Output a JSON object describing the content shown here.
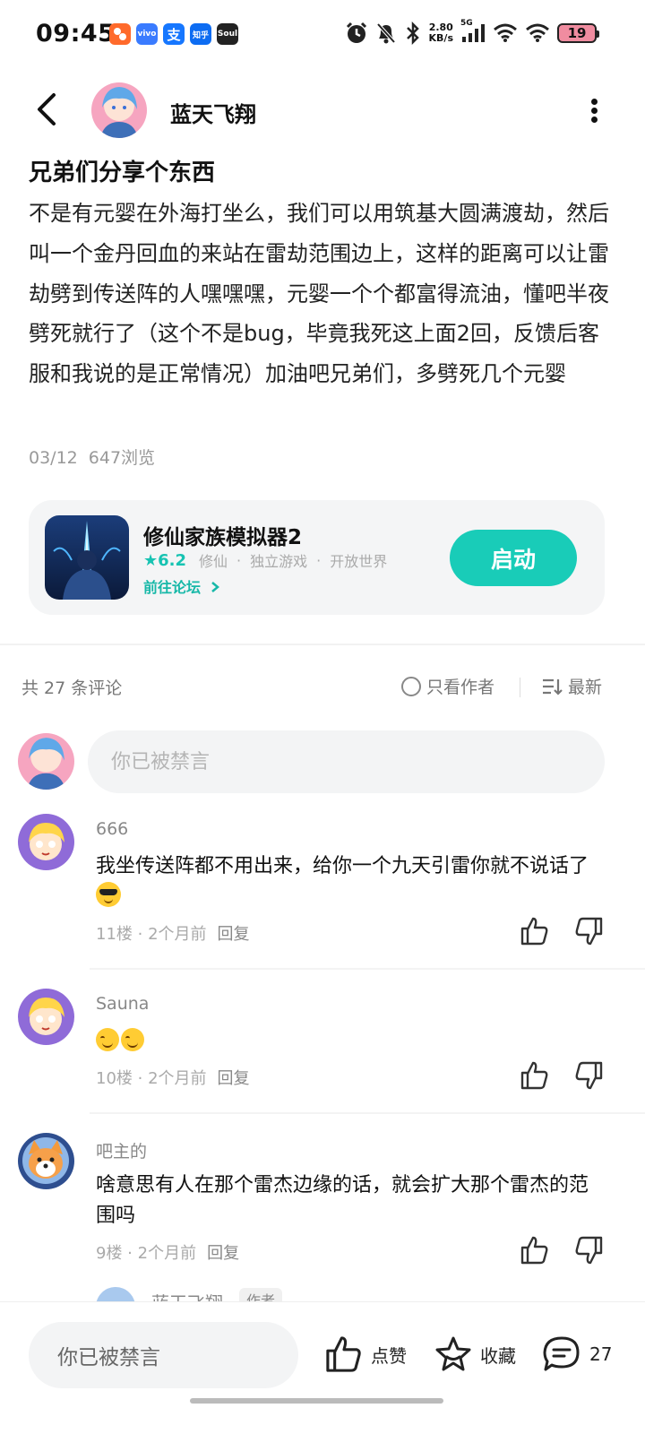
{
  "status_bar": {
    "time": "09:45",
    "apps": [
      {
        "name": "app-1",
        "label": "",
        "color": "#ff6a2b"
      },
      {
        "name": "vivo",
        "label": "vivo",
        "color": "#3a7bff"
      },
      {
        "name": "alipay",
        "label": "支",
        "color": "#1677ff"
      },
      {
        "name": "zhihu",
        "label": "知乎",
        "color": "#0d6cf2"
      },
      {
        "name": "soul",
        "label": "Soul",
        "color": "#222222"
      }
    ],
    "net_speed_value": "2.80",
    "net_speed_unit": "KB/s",
    "network": "5G",
    "battery": "19"
  },
  "header": {
    "username": "蓝天飞翔"
  },
  "post": {
    "title": "兄弟们分享个东西",
    "body": "不是有元婴在外海打坐么，我们可以用筑基大圆满渡劫，然后叫一个金丹回血的来站在雷劫范围边上，这样的距离可以让雷劫劈到传送阵的人嘿嘿嘿，元婴一个个都富得流油，懂吧半夜劈死就行了（这个不是bug，毕竟我死这上面2回，反馈后客服和我说的是正常情况）加油吧兄弟们，多劈死几个元婴",
    "date": "03/12",
    "views": "647浏览"
  },
  "game_card": {
    "name": "修仙家族模拟器2",
    "rating": "6.2",
    "tags": [
      "修仙",
      "独立游戏",
      "开放世界"
    ],
    "forum_link": "前往论坛",
    "launch_label": "启动"
  },
  "comments_header": {
    "count_text": "共 27 条评论",
    "only_author": "只看作者",
    "sort_label": "最新"
  },
  "comment_input": {
    "placeholder": "你已被禁言"
  },
  "comments": [
    {
      "user": "666",
      "text": "我坐传送阵都不用出来，给你一个九天引雷你就不说话了",
      "emoji": "cool",
      "floor": "11楼",
      "time": "2个月前",
      "reply": "回复"
    },
    {
      "user": "Sauna",
      "text": "",
      "emoji": "blush-blush",
      "floor": "10楼",
      "time": "2个月前",
      "reply": "回复"
    },
    {
      "user": "吧主的",
      "text": "啥意思有人在那个雷杰边缘的话，就会扩大那个雷杰的范围吗",
      "emoji": "",
      "floor": "9楼",
      "time": "2个月前",
      "reply": "回复"
    }
  ],
  "reply_preview": {
    "name": "蓝天飞翔",
    "tag": "作者"
  },
  "bottom_bar": {
    "input_text": "你已被禁言",
    "like_label": "点赞",
    "fav_label": "收藏",
    "comment_count": "27"
  },
  "colors": {
    "accent": "#19ccb8",
    "text": "#111111",
    "muted": "#999999"
  }
}
